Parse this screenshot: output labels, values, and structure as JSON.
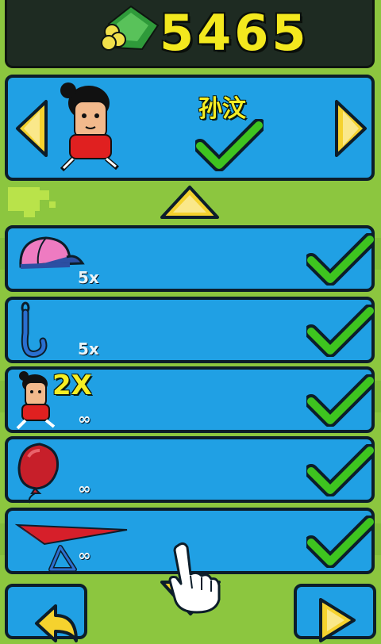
{
  "score": "5465",
  "character": {
    "name": "孙汶"
  },
  "items": [
    {
      "name": "cap",
      "count": "5x"
    },
    {
      "name": "hook",
      "count": "5x"
    },
    {
      "name": "double-character",
      "count": "∞",
      "badge": "2X"
    },
    {
      "name": "balloon",
      "count": "∞"
    },
    {
      "name": "paper-plane",
      "count": "∞"
    }
  ],
  "colors": {
    "background": "#8cc63f",
    "panel": "#20a0e4",
    "topbar": "#1e2b22",
    "score": "#f3e81e",
    "check": "#3ec41f",
    "arrow": "#f5d22e"
  }
}
